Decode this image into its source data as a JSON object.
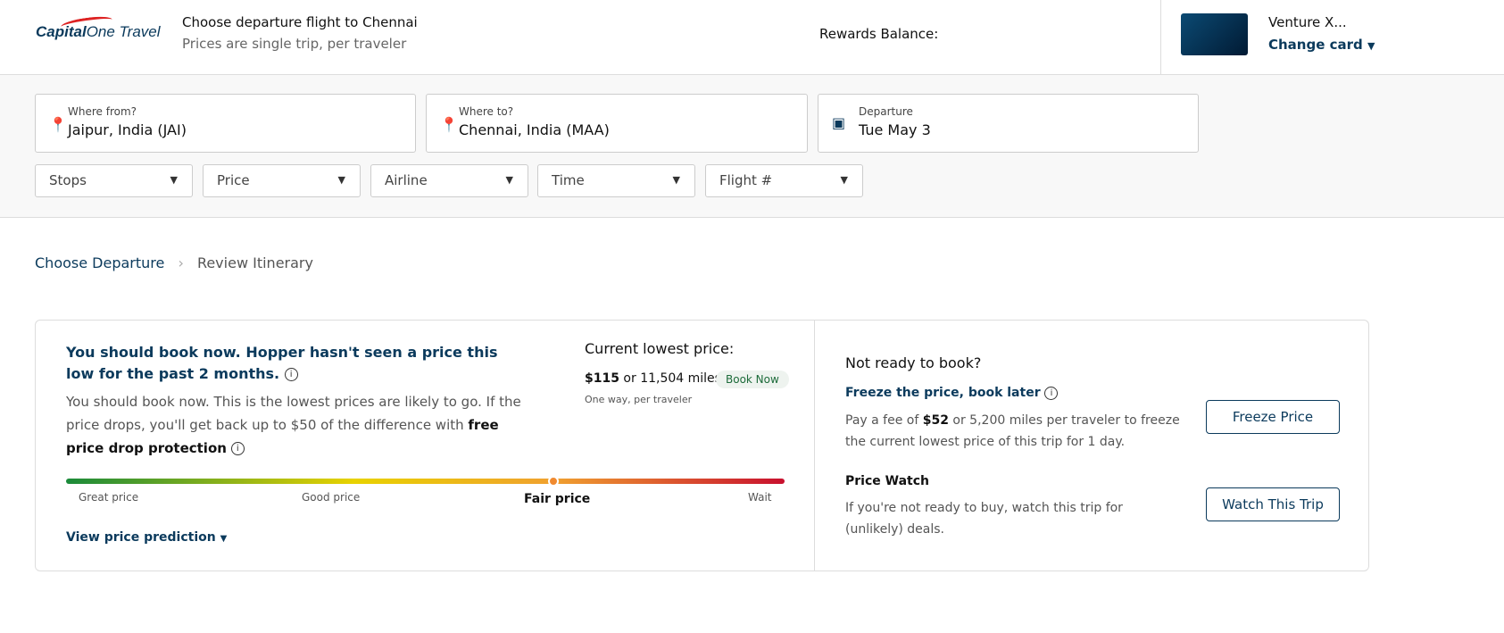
{
  "header": {
    "logo": "Capital One Travel",
    "title": "Choose departure flight to Chennai",
    "subtitle": "Prices are single trip, per traveler",
    "rewards_label": "Rewards Balance:",
    "card_name": "Venture X...",
    "change_card": "Change card"
  },
  "search": {
    "from_label": "Where from?",
    "from_value": "Jaipur, India (JAI)",
    "to_label": "Where to?",
    "to_value": "Chennai, India (MAA)",
    "departure_label": "Departure",
    "departure_value": "Tue May 3",
    "filters": [
      "Stops",
      "Price",
      "Airline",
      "Time",
      "Flight #"
    ]
  },
  "breadcrumb": [
    "Choose Departure",
    "Review Itinerary"
  ],
  "prediction": {
    "headline": "You should book now. Hopper hasn't seen a price this low for the past 2 months.",
    "desc": "You should book now. This is the lowest prices are likely to go. If the price drops, you'll get back up to $50 of the difference with ",
    "desc_bold": "free price drop protection",
    "current_label": "Current lowest price:",
    "price": "$115",
    "miles": " or 11,504 miles",
    "book_now": "Book Now",
    "per": "One way, per traveler",
    "scale": [
      "Great price",
      "Good price",
      "Fair price",
      "Wait"
    ],
    "position_percent": 68,
    "view_prediction": "View price prediction"
  },
  "side": {
    "title": "Not ready to book?",
    "freeze_title": "Freeze the price, book later",
    "freeze_desc_pre": "Pay a fee of ",
    "freeze_fee": "$52",
    "freeze_desc_post": " or 5,200 miles per traveler to freeze the current lowest price of this trip for 1 day.",
    "freeze_btn": "Freeze Price",
    "watch_title": "Price Watch",
    "watch_desc": "If you're not ready to buy, watch this trip for (unlikely) deals.",
    "watch_btn": "Watch This Trip"
  }
}
